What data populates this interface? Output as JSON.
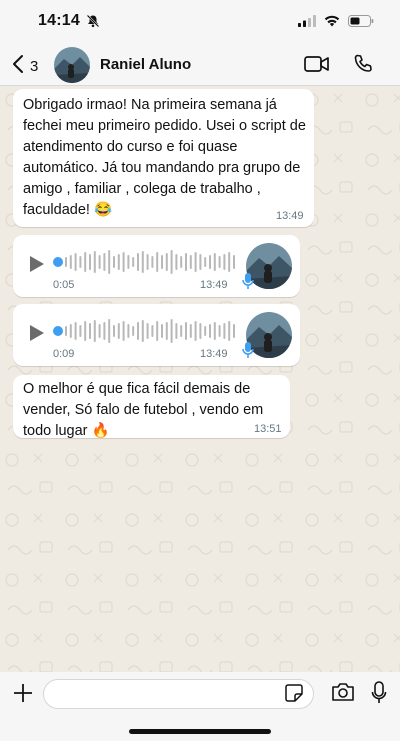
{
  "status": {
    "time": "14:14"
  },
  "header": {
    "back_count": "3",
    "contact_name": "Raniel Aluno"
  },
  "messages": [
    {
      "text": "Obrigado irmao! Na primeira semana já fechei meu primeiro pedido. Usei o script de atendimento do curso e foi quase automático. Já tou mandando pra grupo de  amigo , familiar , colega de trabalho , faculdade! 😂",
      "time": "13:49"
    },
    {
      "duration": "0:05",
      "time": "13:49"
    },
    {
      "duration": "0:09",
      "time": "13:49"
    },
    {
      "text": "O melhor é que fica fácil demais de vender, Só falo de futebol , vendo em todo lugar 🔥",
      "time": "13:51"
    }
  ],
  "input": {
    "placeholder": ""
  },
  "colors": {
    "chat_bg": "#efeae2",
    "bubble": "#ffffff",
    "voice_accent": "#3f9fee"
  }
}
